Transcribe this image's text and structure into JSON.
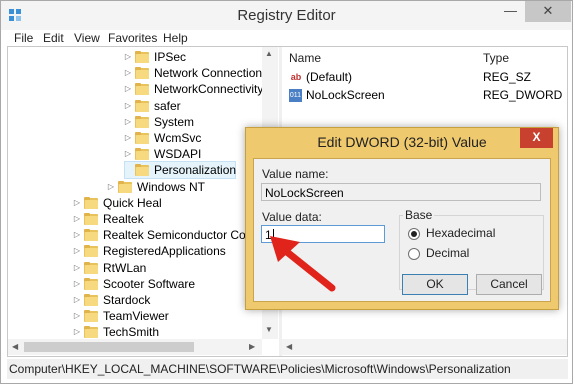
{
  "window": {
    "title": "Registry Editor",
    "minimize": "—",
    "close": "✕"
  },
  "menubar": [
    "File",
    "Edit",
    "View",
    "Favorites",
    "Help"
  ],
  "tree": {
    "items": [
      {
        "label": "IPSec",
        "level": 3
      },
      {
        "label": "Network Connections",
        "level": 3
      },
      {
        "label": "NetworkConnectivitySt",
        "level": 3
      },
      {
        "label": "safer",
        "level": 3
      },
      {
        "label": "System",
        "level": 3
      },
      {
        "label": "WcmSvc",
        "level": 3
      },
      {
        "label": "WSDAPI",
        "level": 3
      },
      {
        "label": "Personalization",
        "level": 3,
        "selected": true
      },
      {
        "label": "Windows NT",
        "level": 2
      },
      {
        "label": "Quick Heal",
        "level": 1
      },
      {
        "label": "Realtek",
        "level": 1
      },
      {
        "label": "Realtek Semiconductor Corp.",
        "level": 1
      },
      {
        "label": "RegisteredApplications",
        "level": 1
      },
      {
        "label": "RtWLan",
        "level": 1
      },
      {
        "label": "Scooter Software",
        "level": 1
      },
      {
        "label": "Stardock",
        "level": 1
      },
      {
        "label": "TeamViewer",
        "level": 1
      },
      {
        "label": "TechSmith",
        "level": 1
      }
    ]
  },
  "values": {
    "columns": [
      "Name",
      "Type"
    ],
    "rows": [
      {
        "name": "(Default)",
        "type": "REG_SZ",
        "icon": "string-value-icon"
      },
      {
        "name": "NoLockScreen",
        "type": "REG_DWORD",
        "icon": "dword-value-icon"
      }
    ]
  },
  "statusbar": {
    "path": "Computer\\HKEY_LOCAL_MACHINE\\SOFTWARE\\Policies\\Microsoft\\Windows\\Personalization"
  },
  "dialog": {
    "title": "Edit DWORD (32-bit) Value",
    "value_name_label": "Value name:",
    "value_name": "NoLockScreen",
    "value_data_label": "Value data:",
    "value_data": "1",
    "base_label": "Base",
    "base_options": [
      "Hexadecimal",
      "Decimal"
    ],
    "base_selected": "Hexadecimal",
    "ok_label": "OK",
    "cancel_label": "Cancel",
    "close": "X"
  },
  "colors": {
    "dialog_frame": "#efc96d",
    "close_button": "#c8412e",
    "annotation_arrow": "#e0241b",
    "selection": "#e5f3fb"
  }
}
